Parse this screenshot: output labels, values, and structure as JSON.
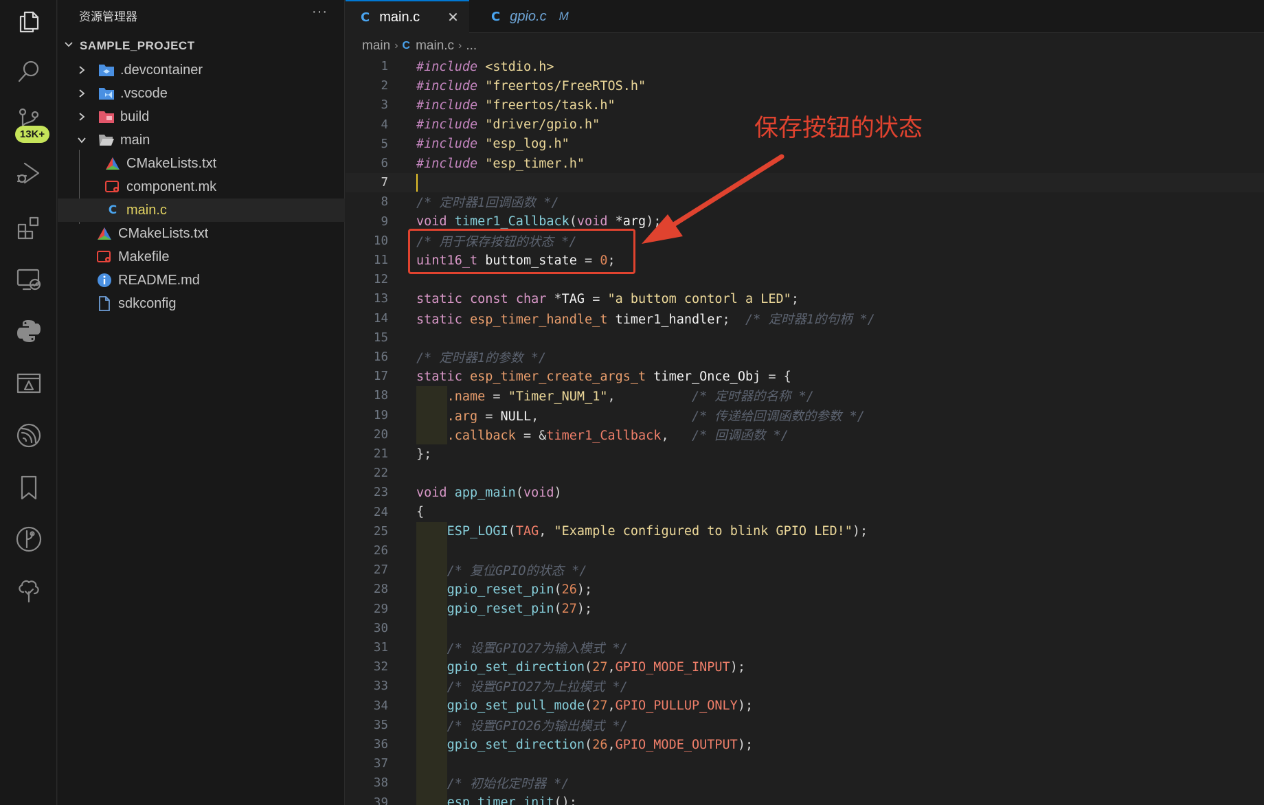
{
  "activity_bar": {
    "icons": [
      "explorer-icon",
      "search-icon",
      "source-control-icon",
      "run-debug-icon",
      "extensions-icon",
      "remote-explorer-icon",
      "python-icon",
      "test-icon",
      "espressif-icon",
      "bookmark-icon",
      "git-graph-icon",
      "tree-icon"
    ],
    "source_control_badge": "13K+"
  },
  "sidebar": {
    "title": "资源管理器",
    "more": "···",
    "project": "SAMPLE_PROJECT",
    "items": [
      {
        "label": ".devcontainer",
        "type": "folder",
        "icon": "devcontainer-folder-icon",
        "color": "#4a90e2",
        "expanded": false
      },
      {
        "label": ".vscode",
        "type": "folder",
        "icon": "vscode-folder-icon",
        "color": "#4a90e2",
        "expanded": false
      },
      {
        "label": "build",
        "type": "folder",
        "icon": "build-folder-icon",
        "color": "#e2566a",
        "expanded": false
      },
      {
        "label": "main",
        "type": "folder",
        "icon": "open-folder-icon",
        "color": "#bfbfbf",
        "expanded": true
      },
      {
        "label": "CMakeLists.txt",
        "type": "file",
        "icon": "cmake-icon",
        "color": "#e8453c"
      },
      {
        "label": "component.mk",
        "type": "file",
        "icon": "makefile-icon",
        "color": "#e8453c"
      },
      {
        "label": "main.c",
        "type": "file",
        "icon": "c-file-icon",
        "color": "#4aa5f0"
      },
      {
        "label": "CMakeLists.txt",
        "type": "file",
        "icon": "cmake-icon",
        "color": "#e8453c"
      },
      {
        "label": "Makefile",
        "type": "file",
        "icon": "makefile-icon",
        "color": "#e8453c"
      },
      {
        "label": "README.md",
        "type": "file",
        "icon": "info-icon",
        "color": "#4a90e2"
      },
      {
        "label": "sdkconfig",
        "type": "file",
        "icon": "file-icon",
        "color": "#6f9fd8"
      }
    ]
  },
  "tabs": [
    {
      "icon": "C",
      "label": "main.c",
      "active": true,
      "close": "✕"
    },
    {
      "icon": "C",
      "label": "gpio.c",
      "active": false,
      "modified": "M"
    }
  ],
  "breadcrumb": {
    "folder": "main",
    "icon": "C",
    "file": "main.c",
    "more": "..."
  },
  "annotation": {
    "text": "保存按钮的状态",
    "color": "#e0432f"
  },
  "editor": {
    "current_line": 7,
    "lines": [
      [
        [
          "pp",
          "#include"
        ],
        [
          "p",
          " "
        ],
        [
          "str",
          "<stdio.h>"
        ]
      ],
      [
        [
          "pp",
          "#include"
        ],
        [
          "p",
          " "
        ],
        [
          "str",
          "\"freertos/FreeRTOS.h\""
        ]
      ],
      [
        [
          "pp",
          "#include"
        ],
        [
          "p",
          " "
        ],
        [
          "str",
          "\"freertos/task.h\""
        ]
      ],
      [
        [
          "pp",
          "#include"
        ],
        [
          "p",
          " "
        ],
        [
          "str",
          "\"driver/gpio.h\""
        ]
      ],
      [
        [
          "pp",
          "#include"
        ],
        [
          "p",
          " "
        ],
        [
          "str",
          "\"esp_log.h\""
        ]
      ],
      [
        [
          "pp",
          "#include"
        ],
        [
          "p",
          " "
        ],
        [
          "str",
          "\"esp_timer.h\""
        ]
      ],
      [],
      [
        [
          "cm",
          "/* 定时器1回调函数 */"
        ]
      ],
      [
        [
          "kw",
          "void"
        ],
        [
          "p",
          " "
        ],
        [
          "fn",
          "timer1_Callback"
        ],
        [
          "p",
          "("
        ],
        [
          "kw",
          "void"
        ],
        [
          "p",
          " *"
        ],
        [
          "var",
          "arg"
        ],
        [
          "p",
          ");"
        ]
      ],
      [
        [
          "cm",
          "/* 用于保存按钮的状态 */"
        ]
      ],
      [
        [
          "kw",
          "uint16_t"
        ],
        [
          "p",
          " "
        ],
        [
          "var",
          "buttom_state"
        ],
        [
          "p",
          " = "
        ],
        [
          "num",
          "0"
        ],
        [
          "p",
          ";"
        ]
      ],
      [],
      [
        [
          "kw",
          "static"
        ],
        [
          "p",
          " "
        ],
        [
          "kw",
          "const"
        ],
        [
          "p",
          " "
        ],
        [
          "kw",
          "char"
        ],
        [
          "p",
          " *"
        ],
        [
          "var",
          "TAG"
        ],
        [
          "p",
          " = "
        ],
        [
          "str",
          "\"a buttom contorl a LED\""
        ],
        [
          "p",
          ";"
        ]
      ],
      [
        [
          "kw",
          "static"
        ],
        [
          "p",
          " "
        ],
        [
          "type",
          "esp_timer_handle_t"
        ],
        [
          "p",
          " "
        ],
        [
          "var",
          "timer1_handler"
        ],
        [
          "p",
          ";  "
        ],
        [
          "cm",
          "/* 定时器1的句柄 */"
        ]
      ],
      [],
      [
        [
          "cm",
          "/* 定时器1的参数 */"
        ]
      ],
      [
        [
          "kw",
          "static"
        ],
        [
          "p",
          " "
        ],
        [
          "type",
          "esp_timer_create_args_t"
        ],
        [
          "p",
          " "
        ],
        [
          "var",
          "timer_Once_Obj"
        ],
        [
          "p",
          " = {"
        ]
      ],
      [
        [
          "p",
          "    "
        ],
        [
          "mem",
          ".name"
        ],
        [
          "p",
          " = "
        ],
        [
          "str",
          "\"Timer_NUM_1\""
        ],
        [
          "p",
          ",          "
        ],
        [
          "cm",
          "/* 定时器的名称 */"
        ]
      ],
      [
        [
          "p",
          "    "
        ],
        [
          "mem",
          ".arg"
        ],
        [
          "p",
          " = "
        ],
        [
          "var",
          "NULL"
        ],
        [
          "p",
          ",                    "
        ],
        [
          "cm",
          "/* 传递给回调函数的参数 */"
        ]
      ],
      [
        [
          "p",
          "    "
        ],
        [
          "mem",
          ".callback"
        ],
        [
          "p",
          " = &"
        ],
        [
          "mac",
          "timer1_Callback"
        ],
        [
          "p",
          ",   "
        ],
        [
          "cm",
          "/* 回调函数 */"
        ]
      ],
      [
        [
          "p",
          "};"
        ]
      ],
      [],
      [
        [
          "kw",
          "void"
        ],
        [
          "p",
          " "
        ],
        [
          "fn",
          "app_main"
        ],
        [
          "p",
          "("
        ],
        [
          "kw",
          "void"
        ],
        [
          "p",
          ")"
        ]
      ],
      [
        [
          "p",
          "{"
        ]
      ],
      [
        [
          "p",
          "    "
        ],
        [
          "fn",
          "ESP_LOGI"
        ],
        [
          "p",
          "("
        ],
        [
          "mac",
          "TAG"
        ],
        [
          "p",
          ", "
        ],
        [
          "str",
          "\"Example configured to blink GPIO LED!\""
        ],
        [
          "p",
          ");"
        ]
      ],
      [],
      [
        [
          "p",
          "    "
        ],
        [
          "cm",
          "/* 复位GPIO的状态 */"
        ]
      ],
      [
        [
          "p",
          "    "
        ],
        [
          "fn",
          "gpio_reset_pin"
        ],
        [
          "p",
          "("
        ],
        [
          "num",
          "26"
        ],
        [
          "p",
          ");"
        ]
      ],
      [
        [
          "p",
          "    "
        ],
        [
          "fn",
          "gpio_reset_pin"
        ],
        [
          "p",
          "("
        ],
        [
          "num",
          "27"
        ],
        [
          "p",
          ");"
        ]
      ],
      [],
      [
        [
          "p",
          "    "
        ],
        [
          "cm",
          "/* 设置GPIO27为输入模式 */"
        ]
      ],
      [
        [
          "p",
          "    "
        ],
        [
          "fn",
          "gpio_set_direction"
        ],
        [
          "p",
          "("
        ],
        [
          "num",
          "27"
        ],
        [
          "p",
          ","
        ],
        [
          "mac",
          "GPIO_MODE_INPUT"
        ],
        [
          "p",
          ");"
        ]
      ],
      [
        [
          "p",
          "    "
        ],
        [
          "cm",
          "/* 设置GPIO27为上拉模式 */"
        ]
      ],
      [
        [
          "p",
          "    "
        ],
        [
          "fn",
          "gpio_set_pull_mode"
        ],
        [
          "p",
          "("
        ],
        [
          "num",
          "27"
        ],
        [
          "p",
          ","
        ],
        [
          "mac",
          "GPIO_PULLUP_ONLY"
        ],
        [
          "p",
          ");"
        ]
      ],
      [
        [
          "p",
          "    "
        ],
        [
          "cm",
          "/* 设置GPIO26为输出模式 */"
        ]
      ],
      [
        [
          "p",
          "    "
        ],
        [
          "fn",
          "gpio_set_direction"
        ],
        [
          "p",
          "("
        ],
        [
          "num",
          "26"
        ],
        [
          "p",
          ","
        ],
        [
          "mac",
          "GPIO_MODE_OUTPUT"
        ],
        [
          "p",
          ");"
        ]
      ],
      [],
      [
        [
          "p",
          "    "
        ],
        [
          "cm",
          "/* 初始化定时器 */"
        ]
      ],
      [
        [
          "p",
          "    "
        ],
        [
          "fn",
          "esp_timer_init"
        ],
        [
          "p",
          "();"
        ]
      ]
    ]
  }
}
